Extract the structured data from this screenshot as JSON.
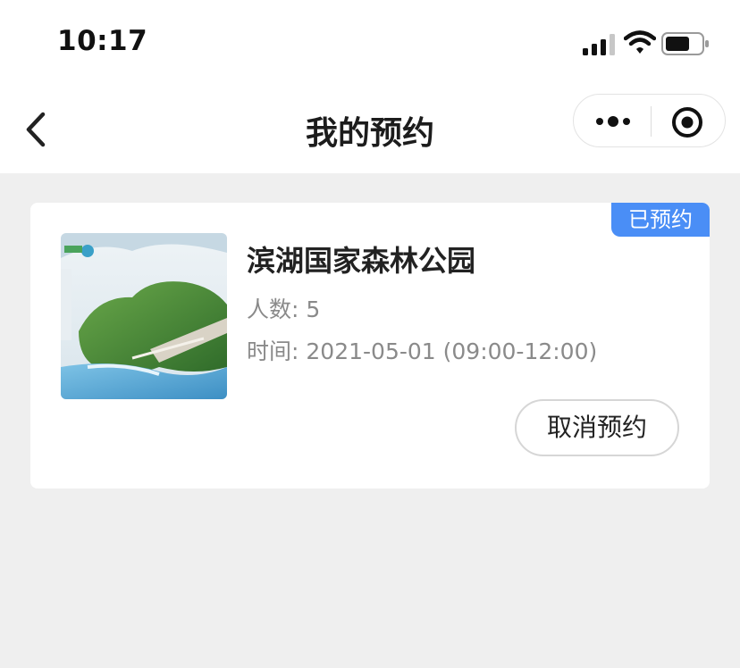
{
  "status_bar": {
    "time": "10:17"
  },
  "nav": {
    "title": "我的预约"
  },
  "reservation": {
    "badge": "已预约",
    "park_name": "滨湖国家森林公园",
    "people_label": "人数:",
    "people_value": "5",
    "time_label": "时间:",
    "time_value": "2021-05-01 (09:00-12:00)",
    "cancel_label": "取消预约"
  },
  "colors": {
    "accent": "#4a8ef6",
    "background": "#efefef",
    "muted_text": "#8a8a8a"
  },
  "icons": {
    "back": "chevron-left-icon",
    "more": "more-dots-icon",
    "close": "target-circle-icon",
    "signal": "cell-signal-icon",
    "wifi": "wifi-icon",
    "battery": "battery-icon"
  }
}
